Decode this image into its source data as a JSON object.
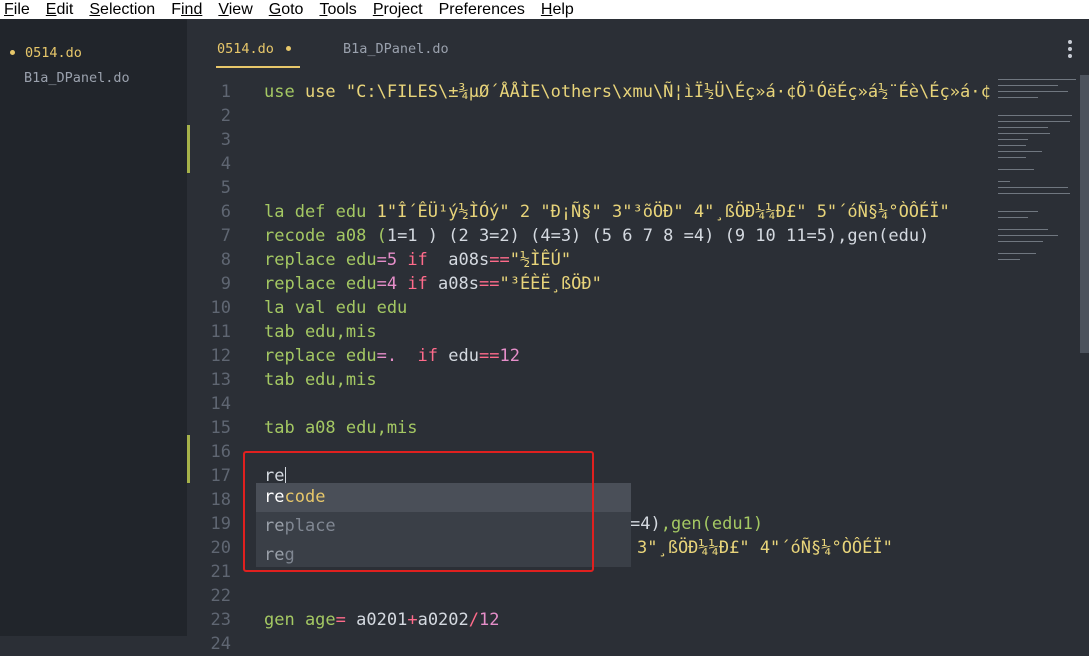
{
  "menu": [
    {
      "label": "File",
      "underline": "F",
      "rest": "ile"
    },
    {
      "label": "Edit",
      "underline": "E",
      "rest": "dit"
    },
    {
      "label": "Selection",
      "underline": "S",
      "rest": "election"
    },
    {
      "label": "Find",
      "underline": "F",
      "rest": "ind"
    },
    {
      "label": "View",
      "underline": "V",
      "rest": "iew"
    },
    {
      "label": "Goto",
      "underline": "G",
      "rest": "oto"
    },
    {
      "label": "Tools",
      "underline": "T",
      "rest": "ools"
    },
    {
      "label": "Project",
      "underline": "P",
      "rest": "roject"
    },
    {
      "label": "Preferences",
      "underline": "n",
      "rest": ""
    },
    {
      "label": "Help",
      "underline": "H",
      "rest": "elp"
    }
  ],
  "sidebar": {
    "files": [
      {
        "name": "0514.do",
        "active": true
      },
      {
        "name": "B1a_DPanel.do",
        "active": false
      }
    ]
  },
  "tabs": [
    {
      "name": "0514.do",
      "active": true,
      "dirty": true
    },
    {
      "name": "B1a_DPanel.do",
      "active": false,
      "dirty": false
    }
  ],
  "gutter": {
    "line_numbers": [
      "1",
      "2",
      "3",
      "4",
      "5",
      "6",
      "7",
      "8",
      "9",
      "10",
      "11",
      "12",
      "13",
      "14",
      "15",
      "16",
      "17",
      "18",
      "19",
      "20",
      "21",
      "22",
      "23",
      "24"
    ]
  },
  "code": {
    "line1": "use \"C:\\FILES\\±¾µØ´ÅÅÌE\\others\\xmu\\Ñ¦ìÏ½Ü\\Éç»á·¢Õ¹ÓëÉç»á½¨Éè\\Éç»á·¢",
    "line6_a": "la def edu ",
    "line6_b": "1\"Î´ÊÜ¹ý½ÌÓý\" 2 \"Ð¡Ñ§\" 3\"³õÖÐ\" 4\"¸ßÖÐ¼¼Ð£\" 5\"´óÑ§¼°ÒÔÉÏ\"",
    "line7_a": "recode a08 (",
    "line7_b": "1=1 ) (2 3=2) (4=3) (5 6 7 8 =4) (9 10 11=5)",
    "line7_c": ",gen(edu)",
    "line8_a": "replace edu",
    "line8_b": "=5 ",
    "line8_c": "if",
    "line8_d": "  a08s",
    "line8_e": "==",
    "line8_f": "\"½ÌÊÚ\"",
    "line9_a": "replace edu",
    "line9_b": "=4 ",
    "line9_c": "if",
    "line9_d": " a08s",
    "line9_e": "==",
    "line9_f": "\"³ÉÈË¸ßÖÐ\"",
    "line10": "la val edu edu",
    "line11": "tab edu,mis",
    "line12_a": "replace edu",
    "line12_b": "=. ",
    "line12_c": " if",
    "line12_d": " edu",
    "line12_e": "==",
    "line12_f": "12",
    "line13": "tab edu,mis",
    "line15": "tab a08 edu,mis",
    "line17": "re",
    "line19_tail_a": "=4)",
    "line19_tail_b": ",gen(edu1)",
    "line20_tail": "3\"¸ßÖÐ¼¼Ð£\" 4\"´óÑ§¼°ÒÔÉÏ\"",
    "line21_tail": "",
    "line23_a": "gen age",
    "line23_b": "= ",
    "line23_c": "a0201",
    "line23_d": "+",
    "line23_e": "a0202",
    "line23_f": "/",
    "line23_g": "12"
  },
  "autocomplete": {
    "items": [
      {
        "match": "re",
        "rest": "code",
        "selected": true
      },
      {
        "match": "re",
        "rest": "place",
        "selected": false
      },
      {
        "match": "re",
        "rest": "g",
        "selected": false
      }
    ]
  },
  "colors": {
    "accent": "#e7c76a",
    "highlight_box": "#e0201f"
  }
}
